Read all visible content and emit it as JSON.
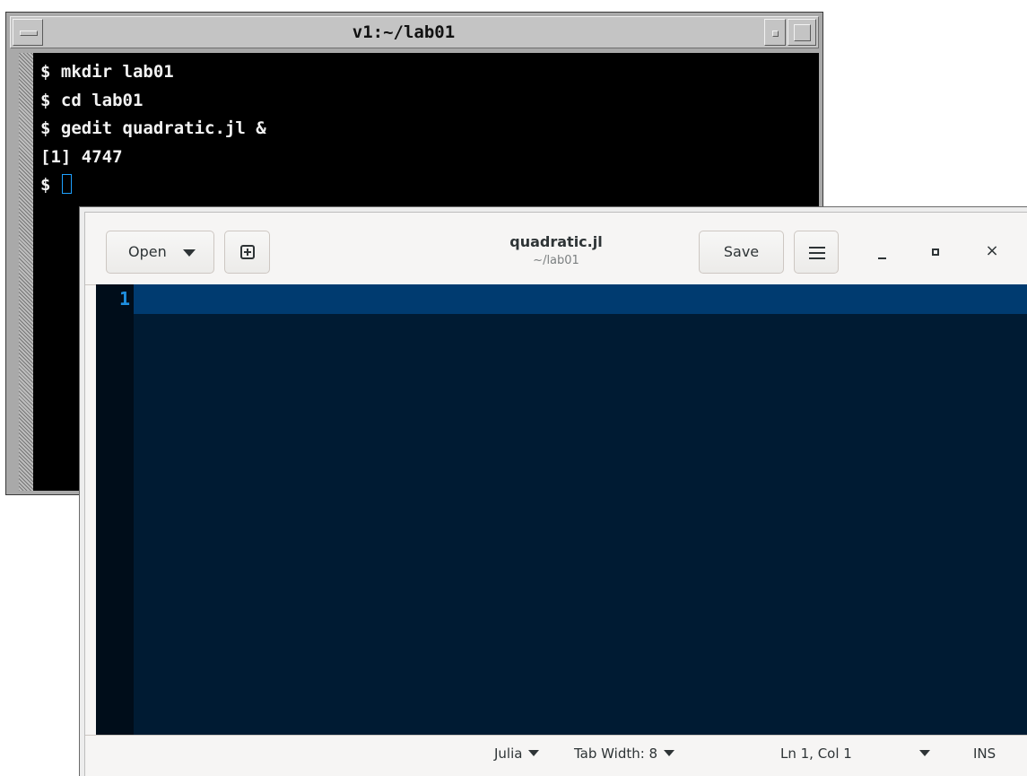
{
  "terminal": {
    "title": "v1:~/lab01",
    "lines": [
      "$ mkdir lab01",
      "$ cd lab01",
      "$ gedit quadratic.jl &",
      "[1] 4747",
      "$ "
    ]
  },
  "gedit": {
    "open_label": "Open",
    "save_label": "Save",
    "title": "quadratic.jl",
    "subtitle": "~/lab01",
    "close_glyph": "×",
    "line_number": "1",
    "status": {
      "language": "Julia",
      "tab_width": "Tab Width: 8",
      "position": "Ln 1, Col 1",
      "mode": "INS"
    }
  },
  "colors": {
    "editor_bg": "#001b33",
    "current_line": "#003b70",
    "line_number": "#1e8fe0",
    "terminal_bg": "#000000",
    "cursor": "#1ea1ff"
  },
  "icons": [
    "menu-icon",
    "minimize-icon",
    "maximize-icon",
    "dropdown-icon",
    "new-tab-icon",
    "hamburger-menu-icon",
    "close-icon"
  ]
}
